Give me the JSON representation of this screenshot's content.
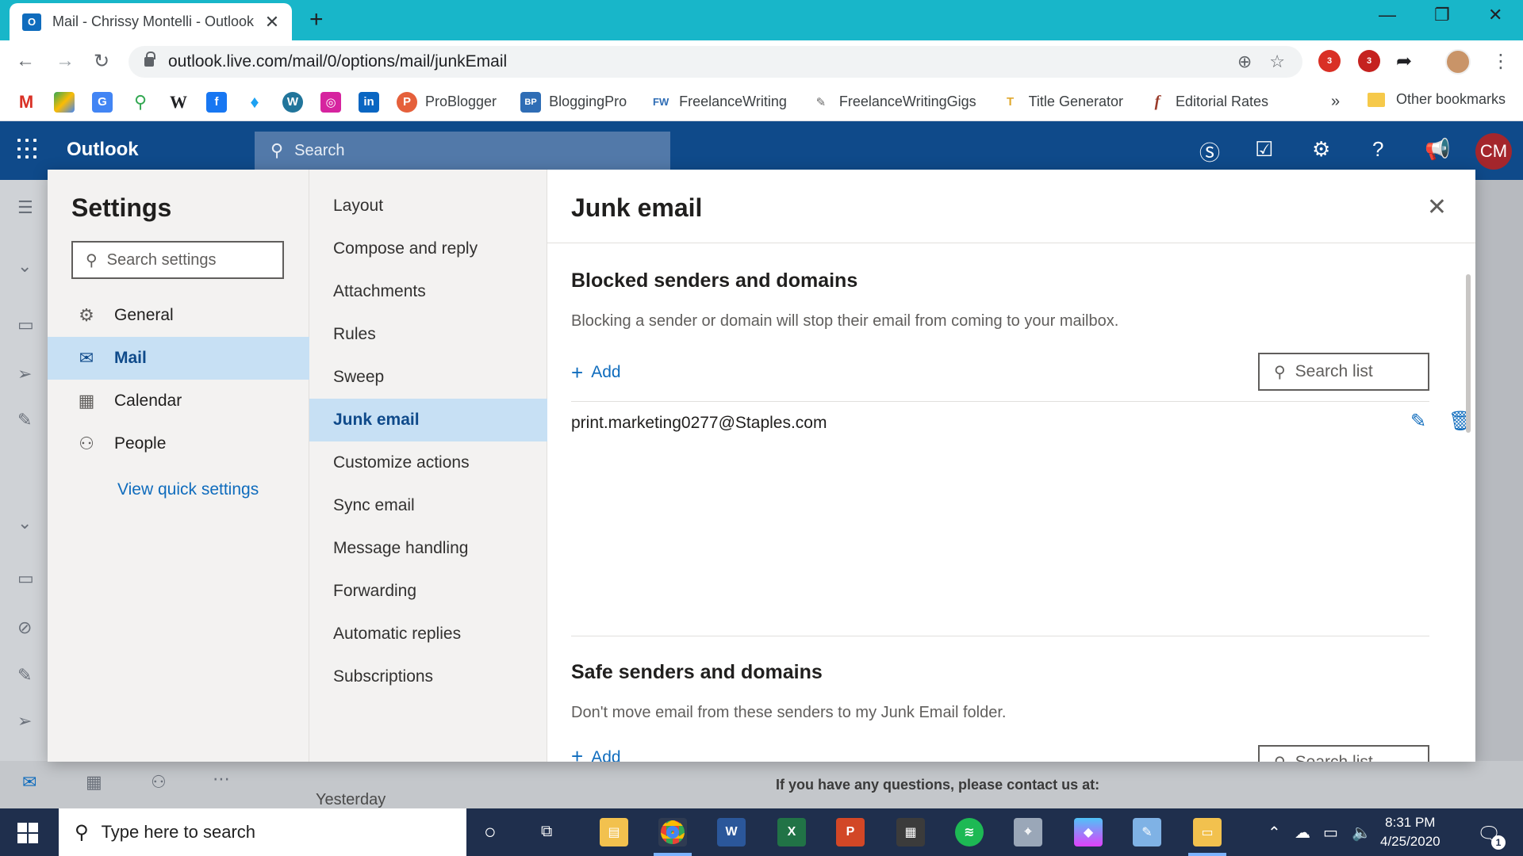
{
  "browser": {
    "tab_title": "Mail - Chrissy Montelli - Outlook",
    "tab_favicon": "O",
    "url": "outlook.live.com/mail/0/options/mail/junkEmail",
    "extension_badges": [
      "3",
      "3"
    ],
    "bookmarks": [
      {
        "label": "ProBlogger",
        "icon": "P",
        "color": "#e5603b"
      },
      {
        "label": "BloggingPro",
        "icon": "BP",
        "color": "#2f6db5"
      },
      {
        "label": "FreelanceWriting",
        "icon": "FW",
        "color": "#2f6db5"
      },
      {
        "label": "FreelanceWritingGigs",
        "icon": "✎",
        "color": "#666666"
      },
      {
        "label": "Title Generator",
        "icon": "T",
        "color": "#e0a82e"
      },
      {
        "label": "Editorial Rates",
        "icon": "f",
        "color": "#9a3b2a"
      }
    ],
    "bookmark_more": "»",
    "other_bookmarks": "Other bookmarks"
  },
  "outlook": {
    "brand": "Outlook",
    "search_placeholder": "Search",
    "avatar_initials": "CM",
    "background_group_label": "Yesterday",
    "background_preview_text": "If you have any questions, please contact us at:"
  },
  "settings": {
    "title": "Settings",
    "search_placeholder": "Search settings",
    "categories": [
      {
        "label": "General",
        "icon": "gear-icon"
      },
      {
        "label": "Mail",
        "icon": "mail-icon"
      },
      {
        "label": "Calendar",
        "icon": "calendar-icon"
      },
      {
        "label": "People",
        "icon": "people-icon"
      }
    ],
    "selected_category": "Mail",
    "quick_settings_link": "View quick settings",
    "mail_options": [
      "Layout",
      "Compose and reply",
      "Attachments",
      "Rules",
      "Sweep",
      "Junk email",
      "Customize actions",
      "Sync email",
      "Message handling",
      "Forwarding",
      "Automatic replies",
      "Subscriptions"
    ],
    "selected_option": "Junk email"
  },
  "junk_email": {
    "title": "Junk email",
    "blocked": {
      "heading": "Blocked senders and domains",
      "description": "Blocking a sender or domain will stop their email from coming to your mailbox.",
      "add_label": "Add",
      "search_list_label": "Search list",
      "entries": [
        "print.marketing0277@Staples.com"
      ]
    },
    "safe": {
      "heading": "Safe senders and domains",
      "description": "Don't move email from these senders to my Junk Email folder.",
      "add_label": "Add",
      "search_list_label": "Search list"
    }
  },
  "taskbar": {
    "search_placeholder": "Type here to search",
    "time": "8:31 PM",
    "date": "4/25/2020",
    "notification_count": "1"
  },
  "colors": {
    "browser_tabbar": "#18b6c9",
    "outlook_header": "#0f4a8a",
    "selected_bg": "#c7e0f4",
    "link": "#0f6cbd",
    "taskbar": "#1f2f4d"
  }
}
